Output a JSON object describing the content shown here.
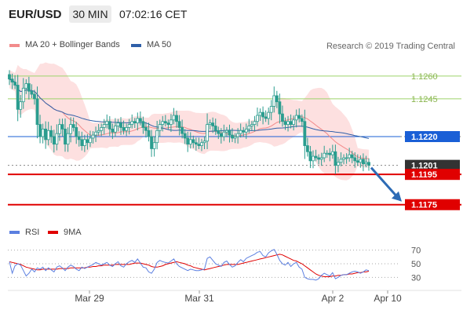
{
  "header": {
    "symbol": "EUR/USD",
    "timeframe": "30 MIN",
    "time": "07:02:16 CET"
  },
  "legend_top": [
    {
      "label": "MA 20 + Bollinger Bands",
      "color": "#f28b8b"
    },
    {
      "label": "MA 50",
      "color": "#2f5fa8"
    }
  ],
  "credit": "Research © 2019 Trading Central",
  "legend_bottom": [
    {
      "label": "RSI",
      "color": "#5b7fe0"
    },
    {
      "label": "9MA",
      "color": "#e00000"
    }
  ],
  "colors": {
    "candle": "#2a9d8f",
    "band": "#fde0e0",
    "ma20": "#f28b8b",
    "ma50": "#2f5fa8",
    "resistance": "#9dd36a",
    "support": "#e00000",
    "pivot": "#1a5fd6",
    "current": "#333333",
    "arrow": "#2d6bb5"
  },
  "chart_data": [
    {
      "type": "candlestick",
      "ylim": [
        1.1165,
        1.1275
      ],
      "x_ticks": [
        "Mar 29",
        "Mar 31",
        "Apr 2",
        "Apr 10"
      ],
      "levels": [
        {
          "value": 1.126,
          "label": "1.1260",
          "kind": "resistance"
        },
        {
          "value": 1.1245,
          "label": "1.1245",
          "kind": "resistance"
        },
        {
          "value": 1.122,
          "label": "1.1220",
          "kind": "pivot"
        },
        {
          "value": 1.1201,
          "label": "1.1201",
          "kind": "current"
        },
        {
          "value": 1.1195,
          "label": "1.1195",
          "kind": "support"
        },
        {
          "value": 1.1175,
          "label": "1.1175",
          "kind": "support"
        }
      ],
      "forecast_arrow": {
        "from": 1.1201,
        "to": 1.1175
      },
      "close": [
        1.1258,
        1.1256,
        1.1254,
        1.1238,
        1.1243,
        1.1252,
        1.1255,
        1.125,
        1.1248,
        1.1245,
        1.1228,
        1.122,
        1.1225,
        1.1218,
        1.1224,
        1.122,
        1.1215,
        1.1222,
        1.1228,
        1.1225,
        1.1215,
        1.1222,
        1.1228,
        1.1226,
        1.122,
        1.1218,
        1.1214,
        1.1218,
        1.1216,
        1.1219,
        1.1221,
        1.1223,
        1.1224,
        1.1226,
        1.1228,
        1.123,
        1.1225,
        1.1223,
        1.1227,
        1.1229,
        1.1226,
        1.1224,
        1.1226,
        1.1228,
        1.123,
        1.1229,
        1.1232,
        1.123,
        1.1226,
        1.1224,
        1.122,
        1.1212,
        1.1216,
        1.1224,
        1.1228,
        1.123,
        1.1229,
        1.1228,
        1.1231,
        1.1234,
        1.123,
        1.1226,
        1.1222,
        1.1219,
        1.1215,
        1.1218,
        1.1216,
        1.1215,
        1.1214,
        1.1216,
        1.1217,
        1.1228,
        1.1229,
        1.1227,
        1.1224,
        1.1222,
        1.122,
        1.1223,
        1.1224,
        1.1221,
        1.1219,
        1.122,
        1.1222,
        1.1224,
        1.1223,
        1.1225,
        1.1227,
        1.1228,
        1.123,
        1.1234,
        1.1236,
        1.1233,
        1.1232,
        1.1236,
        1.124,
        1.1247,
        1.1243,
        1.1235,
        1.123,
        1.1228,
        1.123,
        1.1228,
        1.1231,
        1.1234,
        1.1232,
        1.123,
        1.1214,
        1.121,
        1.1204,
        1.1207,
        1.1206,
        1.1205,
        1.1206,
        1.1209,
        1.1209,
        1.1208,
        1.121,
        1.1201,
        1.1203,
        1.1205,
        1.1206,
        1.1206,
        1.1208,
        1.1206,
        1.1204,
        1.1203,
        1.1205,
        1.1202,
        1.1203,
        1.1201
      ]
    },
    {
      "type": "line",
      "ylim": [
        20,
        80
      ],
      "y_ticks": [
        30,
        50,
        70
      ],
      "series": [
        {
          "name": "RSI",
          "values": [
            53,
            36,
            47,
            50,
            48,
            40,
            32,
            36,
            42,
            38,
            44,
            42,
            45,
            40,
            44,
            41,
            38,
            45,
            47,
            44,
            40,
            45,
            48,
            46,
            42,
            40,
            45,
            43,
            45,
            47,
            49,
            52,
            50,
            48,
            50,
            52,
            48,
            46,
            50,
            53,
            47,
            45,
            50,
            53,
            55,
            52,
            57,
            51,
            45,
            44,
            38,
            36,
            42,
            52,
            55,
            53,
            52,
            51,
            54,
            57,
            50,
            46,
            44,
            42,
            40,
            42,
            41,
            40,
            40,
            41,
            42,
            58,
            60,
            55,
            50,
            48,
            46,
            52,
            54,
            49,
            45,
            47,
            52,
            56,
            53,
            58,
            60,
            62,
            64,
            67,
            68,
            62,
            60,
            66,
            69,
            71,
            64,
            55,
            50,
            48,
            52,
            46,
            50,
            52,
            45,
            42,
            30,
            28,
            27,
            27,
            26,
            28,
            33,
            36,
            34,
            32,
            37,
            28,
            30,
            33,
            34,
            34,
            36,
            38,
            39,
            38,
            36,
            38,
            41,
            40
          ]
        },
        {
          "name": "9MA",
          "values": [
            53,
            52,
            51,
            50,
            49,
            47,
            45,
            44,
            43,
            42,
            41,
            41,
            42,
            42,
            42,
            42,
            42,
            42,
            43,
            43,
            43,
            43,
            44,
            44,
            44,
            44,
            44,
            44,
            45,
            45,
            46,
            46,
            47,
            47,
            48,
            48,
            48,
            48,
            49,
            49,
            49,
            49,
            49,
            49,
            50,
            51,
            51,
            51,
            50,
            49,
            48,
            46,
            45,
            45,
            46,
            47,
            49,
            50,
            51,
            52,
            53,
            52,
            51,
            50,
            48,
            47,
            45,
            44,
            43,
            42,
            41,
            42,
            43,
            44,
            45,
            46,
            47,
            48,
            49,
            49,
            49,
            49,
            49,
            50,
            51,
            52,
            53,
            54,
            55,
            56,
            57,
            58,
            59,
            60,
            61,
            62,
            63,
            64,
            63,
            61,
            59,
            57,
            55,
            54,
            52,
            50,
            47,
            44,
            41,
            38,
            35,
            33,
            32,
            31,
            31,
            31,
            32,
            32,
            33,
            33,
            34,
            34,
            35,
            35,
            36,
            37,
            37,
            38,
            38,
            39
          ]
        }
      ]
    }
  ]
}
